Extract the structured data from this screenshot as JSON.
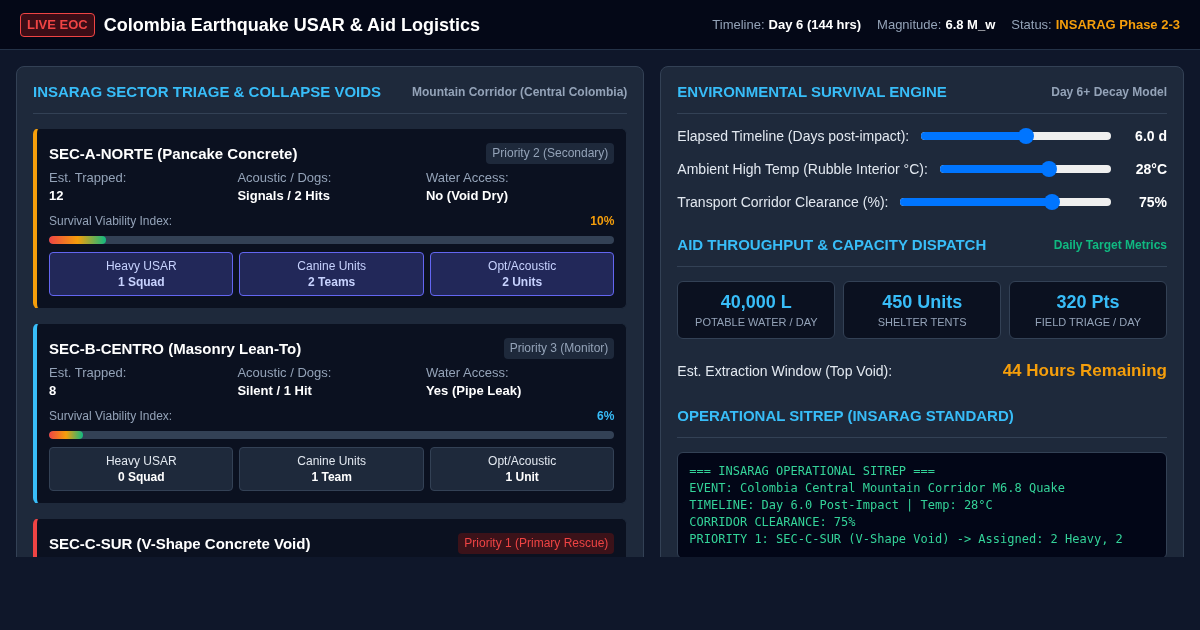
{
  "header": {
    "badge": "LIVE EOC",
    "title": "Colombia Earthquake USAR & Aid Logistics",
    "stats": [
      {
        "label": "Timeline:",
        "value": "Day 6 (144 hrs)",
        "kind": "plain"
      },
      {
        "label": "Magnitude:",
        "value": "6.8 M_w",
        "kind": "plain"
      },
      {
        "label": "Status:",
        "value": "INSARAG Phase 2-3",
        "kind": "warning"
      }
    ]
  },
  "sectors_panel": {
    "title": "INSARAG SECTOR TRIAGE & COLLAPSE VOIDS",
    "subtitle": "Mountain Corridor (Central Colombia)",
    "sectors": [
      {
        "name": "SEC-A-NORTE (Pancake Concrete)",
        "priority": "Priority 2 (Secondary)",
        "urgent": false,
        "color": "#f59e0b",
        "stats": [
          {
            "label": "Est. Trapped:",
            "value": "12"
          },
          {
            "label": "Acoustic / Dogs:",
            "value": "Signals / 2 Hits"
          },
          {
            "label": "Water Access:",
            "value": "No (Void Dry)"
          }
        ],
        "viability_label": "Survival Viability Index:",
        "viability": "10%",
        "level": 0.1,
        "resources": [
          {
            "label": "Heavy USAR",
            "value": "1 Squad",
            "active": true
          },
          {
            "label": "Canine Units",
            "value": "2 Teams",
            "active": true
          },
          {
            "label": "Opt/Acoustic",
            "value": "2 Units",
            "active": true
          }
        ]
      },
      {
        "name": "SEC-B-CENTRO (Masonry Lean-To)",
        "priority": "Priority 3 (Monitor)",
        "urgent": false,
        "color": "#38bdf8",
        "stats": [
          {
            "label": "Est. Trapped:",
            "value": "8"
          },
          {
            "label": "Acoustic / Dogs:",
            "value": "Silent / 1 Hit"
          },
          {
            "label": "Water Access:",
            "value": "Yes (Pipe Leak)"
          }
        ],
        "viability_label": "Survival Viability Index:",
        "viability": "6%",
        "level": 0.06,
        "resources": [
          {
            "label": "Heavy USAR",
            "value": "0 Squad",
            "active": false
          },
          {
            "label": "Canine Units",
            "value": "1 Team",
            "active": false
          },
          {
            "label": "Opt/Acoustic",
            "value": "1 Unit",
            "active": false
          }
        ]
      },
      {
        "name": "SEC-C-SUR (V-Shape Concrete Void)",
        "priority": "Priority 1 (Primary Rescue)",
        "urgent": true,
        "color": "#ef4444"
      }
    ]
  },
  "right_panel": {
    "environment": {
      "title": "ENVIRONMENTAL SURVIVAL ENGINE",
      "subtitle": "Day 6+ Decay Model",
      "sliders": [
        {
          "label": "Elapsed Timeline (Days post-impact):",
          "value": "6.0 d",
          "level": 0.55
        },
        {
          "label": "Ambient High Temp (Rubble Interior °C):",
          "value": "28°C",
          "level": 0.64
        },
        {
          "label": "Transport Corridor Clearance (%):",
          "value": "75%",
          "level": 0.72
        }
      ]
    },
    "aid": {
      "title": "AID THROUGHPUT & CAPACITY DISPATCH",
      "subtitle": "Daily Target Metrics",
      "metrics": [
        {
          "value": "40,000 L",
          "label": "POTABLE WATER / DAY"
        },
        {
          "value": "450 Units",
          "label": "SHELTER TENTS"
        },
        {
          "value": "320 Pts",
          "label": "FIELD TRIAGE / DAY"
        }
      ],
      "extraction": {
        "label": "Est. Extraction Window (Top Void):",
        "value": "44 Hours Remaining"
      }
    },
    "sitrep": {
      "title": "OPERATIONAL SITREP (INSARAG STANDARD)",
      "lines": [
        "=== INSARAG OPERATIONAL SITREP ===",
        "EVENT: Colombia Central Mountain Corridor M6.8 Quake",
        "TIMELINE: Day 6.0 Post-Impact | Temp: 28°C",
        "CORRIDOR CLEARANCE: 75%",
        "PRIORITY 1: SEC-C-SUR (V-Shape Void) -> Assigned: 2 Heavy, 2"
      ]
    }
  }
}
